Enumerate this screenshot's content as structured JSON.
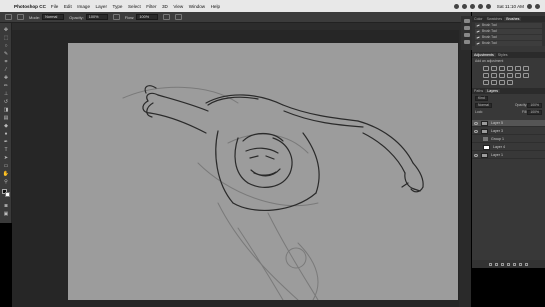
{
  "menubar": {
    "apple": "",
    "app_name": "Photoshop CC",
    "items": [
      "File",
      "Edit",
      "Image",
      "Layer",
      "Type",
      "Select",
      "Filter",
      "3D",
      "View",
      "Window",
      "Help"
    ],
    "clock": "Sat 11:10 AM"
  },
  "options_bar": {
    "mode_label": "Mode:",
    "mode_value": "Normal",
    "opacity_label": "Opacity:",
    "opacity_value": "100%",
    "flow_label": "Flow:",
    "flow_value": "100%"
  },
  "presets_panel": {
    "tabs": [
      "Color",
      "Swatches",
      "Brushes"
    ],
    "active_tab": "Brushes",
    "items": [
      "Brush Tool",
      "Brush Tool",
      "Brush Tool",
      "Brush Tool",
      "Brush Tool"
    ]
  },
  "adjustments_panel": {
    "tabs": [
      "Adjustments",
      "Styles"
    ],
    "subtitle": "Add an adjustment"
  },
  "layers_panel": {
    "tabs": [
      "Paths",
      "Layers"
    ],
    "kind_label": "Kind",
    "blend_mode": "Normal",
    "opacity_label": "Opacity:",
    "opacity_value": "100%",
    "lock_label": "Lock:",
    "fill_label": "Fill:",
    "fill_value": "100%",
    "layers": [
      {
        "name": "Layer 5",
        "type": "layer",
        "visible": true,
        "active": true
      },
      {
        "name": "Layer 3",
        "type": "layer",
        "visible": true,
        "active": false
      },
      {
        "name": "Group 1",
        "type": "group",
        "visible": false,
        "active": false
      },
      {
        "name": "Layer 4",
        "type": "white",
        "visible": false,
        "active": false
      },
      {
        "name": "Layer 1",
        "type": "layer",
        "visible": true,
        "active": false
      }
    ]
  },
  "colors": {
    "canvas": "#9c9c9c",
    "ui_dark": "#383838",
    "menubar": "#e8e8e8"
  }
}
